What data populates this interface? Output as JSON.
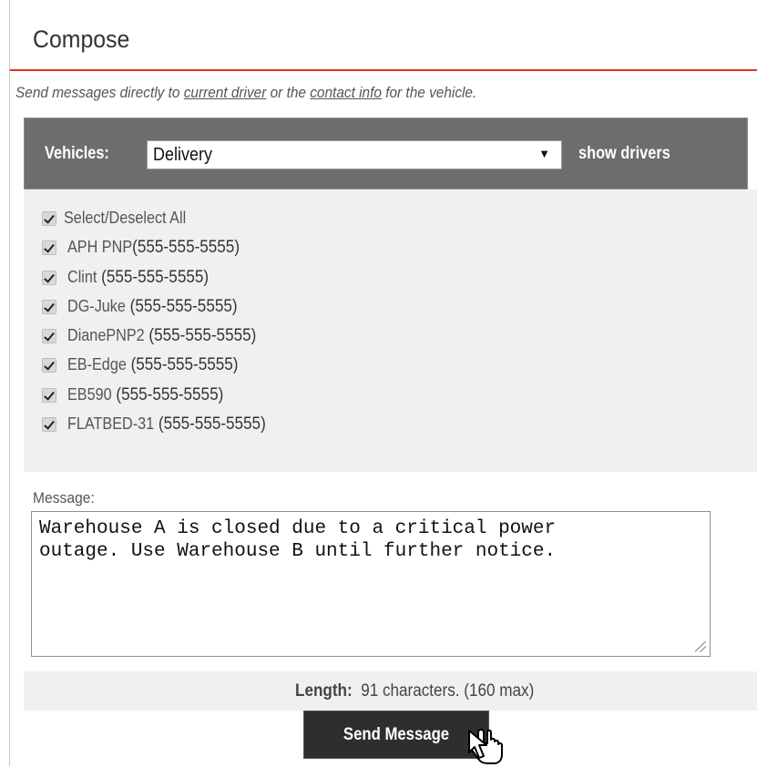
{
  "header": {
    "title": "Compose"
  },
  "subtitle": {
    "prefix": "Send messages directly to ",
    "link1": "current driver",
    "middle": " or the ",
    "link2": "contact info",
    "suffix": " for the vehicle."
  },
  "vehicles": {
    "label": "Vehicles:",
    "selected": "Delivery",
    "caret": "▼",
    "show_drivers": "show drivers"
  },
  "select_all": {
    "label": "Select/Deselect All",
    "checked": true
  },
  "drivers": [
    {
      "name": "APH PNP",
      "phone": "(555-555-5555)",
      "checked": true
    },
    {
      "name": "Clint",
      "phone": "(555-555-5555)",
      "checked": true
    },
    {
      "name": "DG-Juke",
      "phone": "(555-555-5555)",
      "checked": true
    },
    {
      "name": "DianePNP2",
      "phone": "(555-555-5555)",
      "checked": true
    },
    {
      "name": "EB-Edge",
      "phone": "(555-555-5555)",
      "checked": true
    },
    {
      "name": "EB590",
      "phone": "(555-555-5555)",
      "checked": true
    },
    {
      "name": "FLATBED-31",
      "phone": "(555-555-5555)",
      "checked": true
    }
  ],
  "message": {
    "label": "Message:",
    "text": "Warehouse A is closed due to a critical power\noutage. Use Warehouse B until further notice."
  },
  "length": {
    "label": "Length:",
    "value": "91 characters. (160 max)"
  },
  "send_button": {
    "label": "Send Message"
  },
  "colors": {
    "accent_rule": "#d9342b",
    "bar_bg": "#6d6d6d",
    "list_bg": "#f0f0f0",
    "button_bg": "#2e2e2e"
  },
  "icons": [
    "checkbox-checked-icon",
    "dropdown-caret-icon",
    "resize-grip-icon",
    "hand-cursor-icon"
  ]
}
